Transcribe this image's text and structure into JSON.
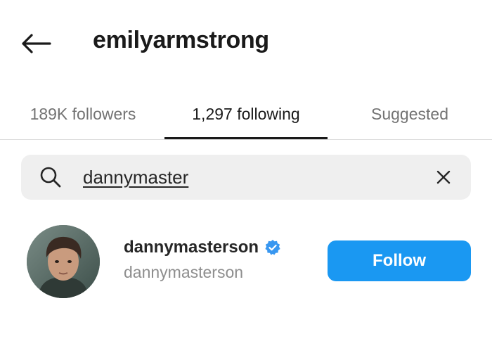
{
  "header": {
    "back_icon": "arrow-left-icon",
    "title": "emilyarmstrong"
  },
  "tabs": [
    {
      "label": "189K followers",
      "active": false
    },
    {
      "label": "1,297 following",
      "active": true
    },
    {
      "label": "Suggested",
      "active": false
    }
  ],
  "search": {
    "icon": "search-icon",
    "value": "dannymaster",
    "clear_icon": "close-icon"
  },
  "results": [
    {
      "username": "dannymasterson",
      "verified": true,
      "display_name": "dannymasterson",
      "action_label": "Follow"
    }
  ],
  "colors": {
    "accent": "#1a98f2",
    "verified_badge": "#3897f0",
    "secondary_text": "#8e8e8e",
    "search_bg": "#efefef"
  }
}
